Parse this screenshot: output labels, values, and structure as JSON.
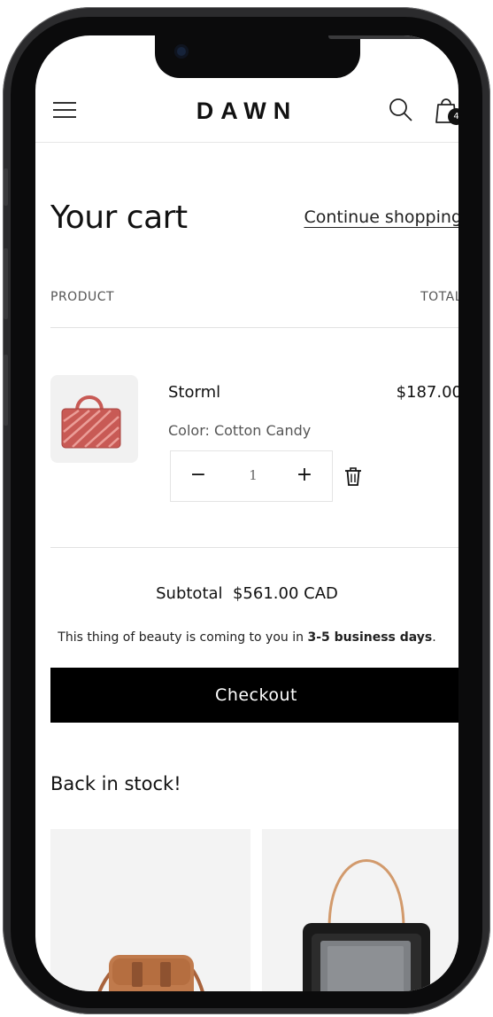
{
  "header": {
    "logo": "DAWN",
    "cart_count": "4"
  },
  "cart": {
    "title": "Your cart",
    "continue_label": "Continue shopping",
    "col_product": "PRODUCT",
    "col_total": "TOTAL",
    "items": [
      {
        "name": "Storml",
        "variant": "Color: Cotton Candy",
        "price": "$187.00",
        "quantity": "1"
      }
    ],
    "subtotal": "Subtotal  $561.00 CAD",
    "delivery_prefix": "This thing of beauty is coming to you in ",
    "delivery_bold": "3-5 business days",
    "delivery_suffix": ".",
    "checkout_label": "Checkout"
  },
  "recommendations": {
    "title": "Back in stock!"
  },
  "colors": {
    "product_bag": "#c85a55",
    "card_bg": "#f3f3f3",
    "button": "#000000"
  },
  "icons": [
    "hamburger-icon",
    "search-icon",
    "bag-icon",
    "minus-icon",
    "plus-icon",
    "trash-icon"
  ]
}
